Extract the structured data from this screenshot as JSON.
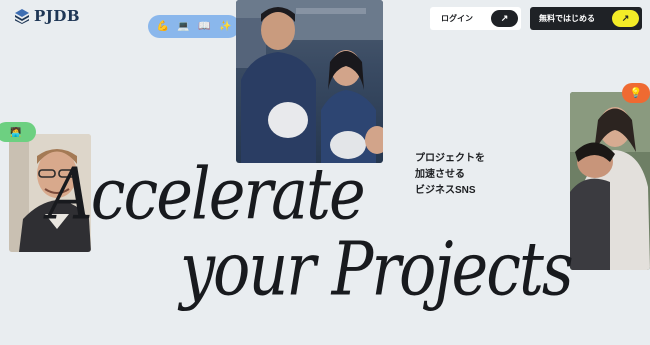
{
  "header": {
    "logo_text": "PJDB",
    "login_label": "ログイン",
    "signup_label": "無料ではじめる",
    "arrow_glyph": "↗"
  },
  "pill": {
    "emojis": [
      "💪",
      "💻",
      "📖",
      "✨"
    ]
  },
  "badges": {
    "left": "🧑‍💻",
    "right": "💡"
  },
  "tagline": {
    "line1": "プロジェクトを",
    "line2": "加速させる",
    "line3": "ビジネスSNS"
  },
  "headline": {
    "line1": "Accelerate",
    "line2": "your Projects"
  },
  "colors": {
    "background": "#e9edf0",
    "brand_navy": "#1e3655",
    "accent_yellow": "#f3ec27",
    "pill_blue": "#8ab7ec",
    "badge_green": "#6dd081",
    "badge_orange": "#ef6a32"
  }
}
